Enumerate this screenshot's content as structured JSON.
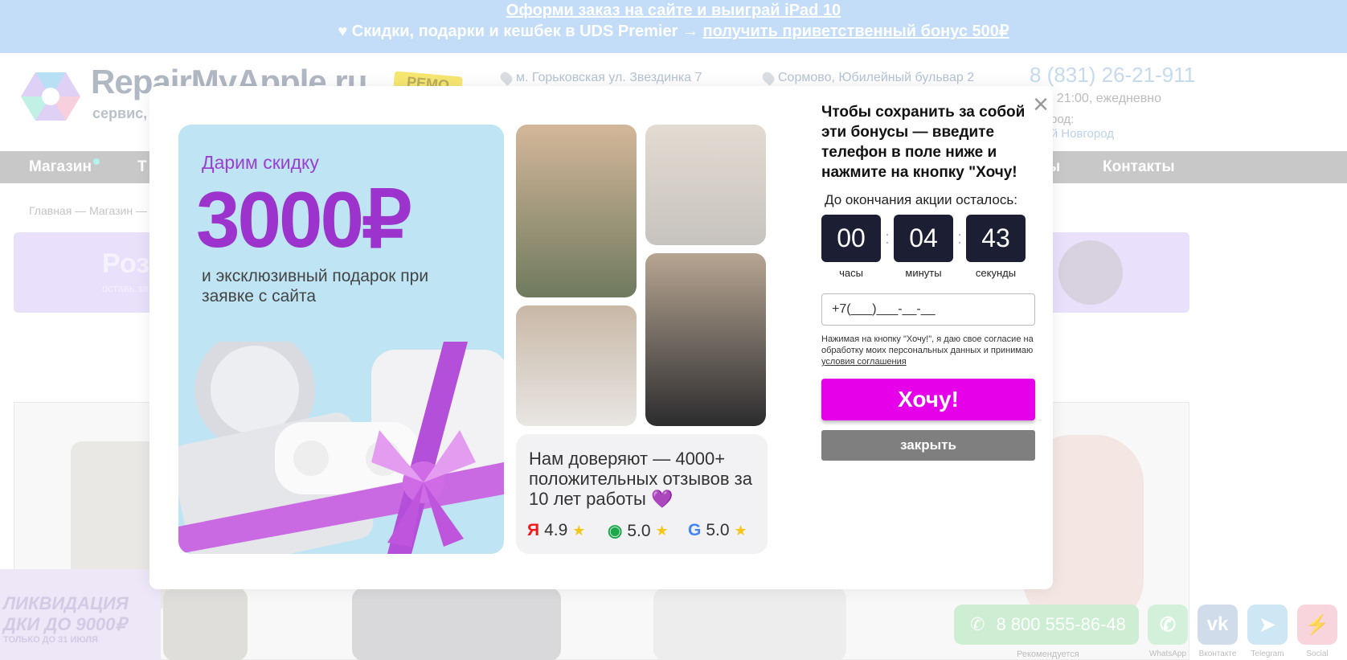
{
  "topbar": {
    "line1": "Оформи заказ на сайте и выиграй iPad 10",
    "line2_prefix": "Скидки, подарки и кешбек в UDS Premier →",
    "line2_link": "получить приветственный бонус 500₽"
  },
  "header": {
    "logo_text": "RepairMyApple.ru",
    "logo_sub": "сервис, ",
    "badge": "РЕМО",
    "address1": "м. Горьковская ул. Звездинка 7",
    "address2": "Сормово, Юбилейный бульвар 2",
    "phone": "8 (831) 26-21-911",
    "hours": "0 — 21:00, ежедневно",
    "city_label": "й город:",
    "city": "жний Новгород"
  },
  "nav": {
    "shop": "Магазин",
    "second": "Т",
    "ellipsis": "ы",
    "contacts": "Контакты"
  },
  "breadcrumbs": "Главная — Магазин —",
  "promo": {
    "title": "Роз",
    "sub": "оставь за"
  },
  "liquidation": {
    "line1": "ЛИКВИДАЦИЯ",
    "line2": "ДКИ ДО 9000₽",
    "line3": "ТОЛЬКО ДО 31 ИЮЛЯ"
  },
  "contacts_bar": {
    "phone": "8 800 555-86-48",
    "hint": "Рекомендуется",
    "whatsapp": "WhatsApp",
    "vk": "Вконтакте",
    "telegram": "Telegram",
    "social": "Social"
  },
  "modal": {
    "gift_kicker": "Дарим скидку",
    "gift_amount": "3000₽",
    "gift_text": "и эксклюзивный подарок при заявке с сайта",
    "reviews_text": "Нам доверяют — 4000+ положительных отзывов за 10 лет работы 💜",
    "ratings": [
      {
        "source": "Я",
        "value": "4.9",
        "color": "#f11a1a"
      },
      {
        "source": "◉",
        "value": "5.0",
        "color": "#1ba84b"
      },
      {
        "source": "G",
        "value": "5.0",
        "color": "#4285f4"
      }
    ],
    "form_title": "Чтобы сохранить за собой эти бонусы — введите телефон в поле ниже и нажмите на кнопку \"Хочу!",
    "countdown_label": "До окончания акции осталось:",
    "timer": {
      "hours": "00",
      "minutes": "04",
      "seconds": "43",
      "hours_label": "часы",
      "minutes_label": "минуты",
      "seconds_label": "секунды"
    },
    "phone_value": "+7(___)___-__-__",
    "consent_text": "Нажимая на кнопку \"Хочу!\", я даю свое согласие на обработку моих персональных данных и принимаю ",
    "consent_link": "условия соглашения",
    "want_label": "Хочу!",
    "close_label": "закрыть",
    "close_icon": "×"
  },
  "colors": {
    "topbar": "#b3d4f8",
    "accent_magenta": "#e600ea",
    "timer_bg": "#1c1f33",
    "gift_purple": "#9b33cc"
  }
}
